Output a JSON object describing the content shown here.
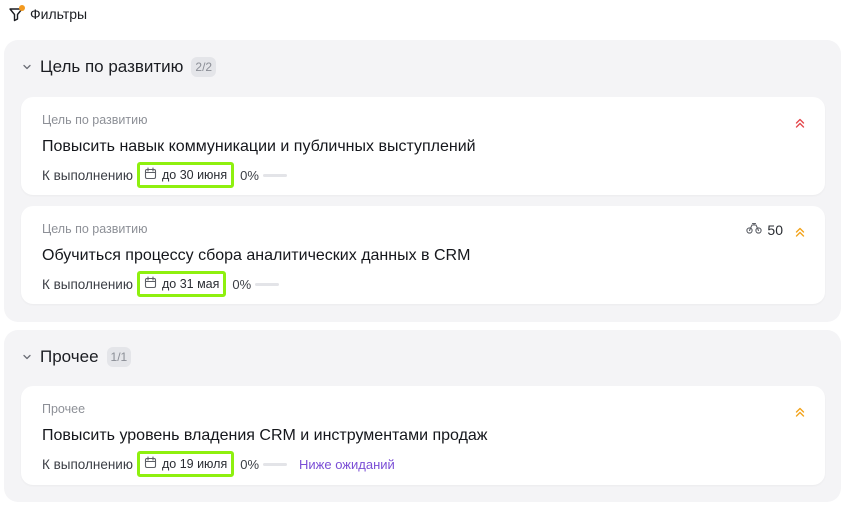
{
  "filters": {
    "label": "Фильтры",
    "dot_color": "#f39a1f"
  },
  "sections": [
    {
      "title": "Цель по развитию",
      "count": "2/2",
      "cards": [
        {
          "category": "Цель по развитию",
          "title": "Повысить навык коммуникации и публичных выступлений",
          "status": "К выполнению",
          "due": "до 30 июня",
          "progress": "0%",
          "progress_value": 0,
          "priority_icon": "double-chevron-up-icon",
          "priority_color": "#e5484d"
        },
        {
          "category": "Цель по развитию",
          "title": "Обучиться процессу сбора аналитических данных в CRM",
          "status": "К выполнению",
          "due": "до 31 мая",
          "progress": "0%",
          "progress_value": 0,
          "score": "50",
          "score_icon": "scales-icon",
          "priority_icon": "double-chevron-up-icon",
          "priority_color": "#f2a31b"
        }
      ]
    },
    {
      "title": "Прочее",
      "count": "1/1",
      "cards": [
        {
          "category": "Прочее",
          "title": "Повысить уровень владения CRM и инструментами продаж",
          "status": "К выполнению",
          "due": "до 19 июля",
          "progress": "0%",
          "progress_value": 0,
          "expectation": "Ниже ожиданий",
          "priority_icon": "double-chevron-up-icon",
          "priority_color": "#f2a31b"
        }
      ]
    }
  ],
  "colors": {
    "highlight": "#8ef00f",
    "link": "#7b4fd6",
    "section_bg": "#f4f4f6"
  }
}
